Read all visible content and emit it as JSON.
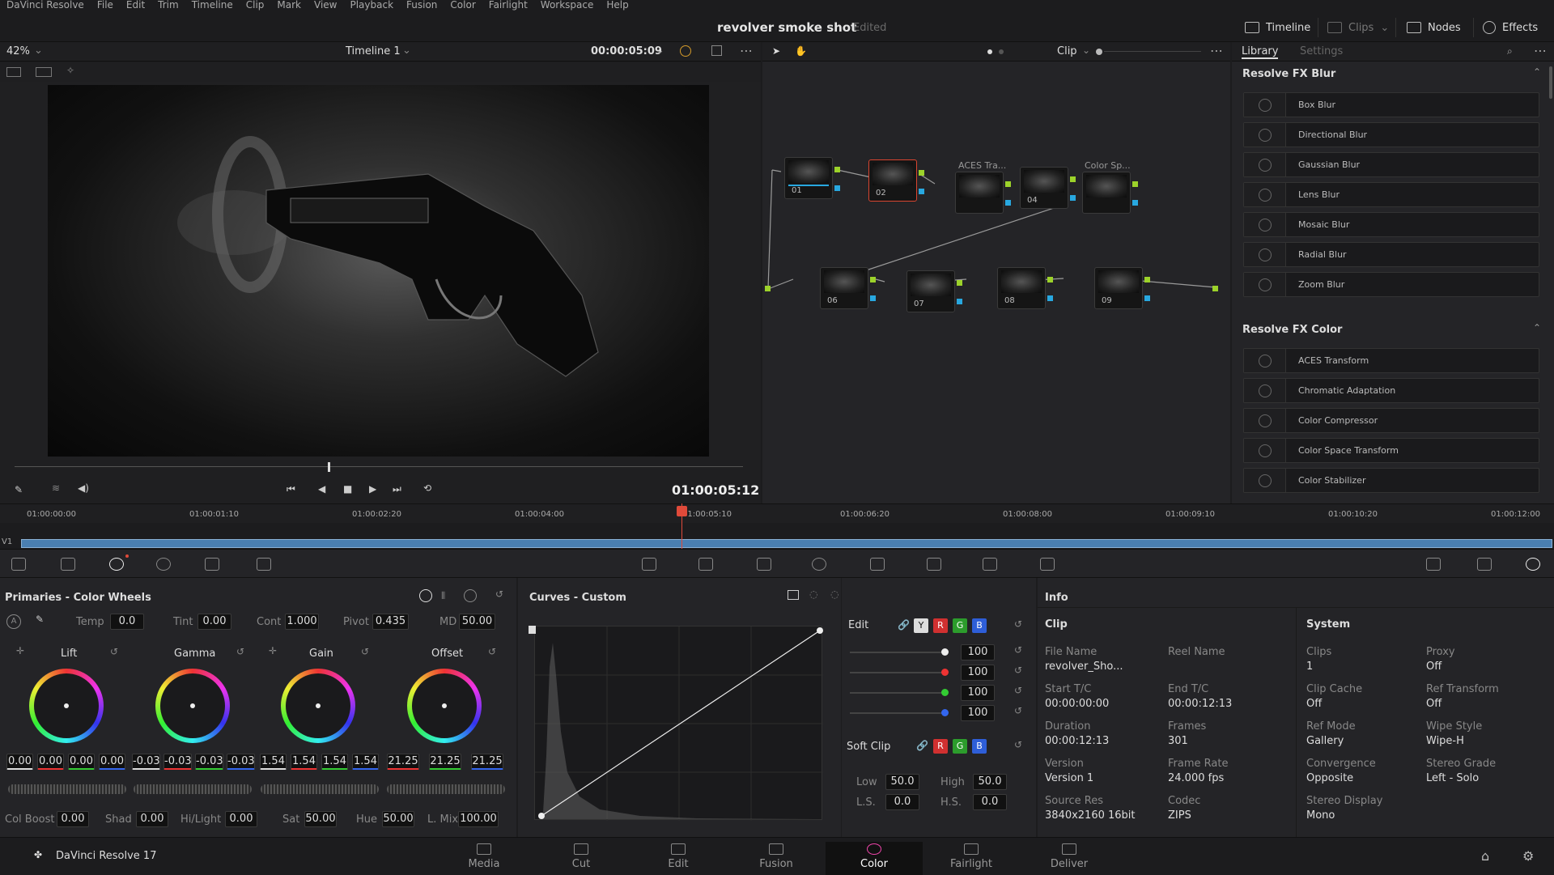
{
  "menu": [
    "DaVinci Resolve",
    "File",
    "Edit",
    "Trim",
    "Timeline",
    "Clip",
    "Mark",
    "View",
    "Playback",
    "Fusion",
    "Color",
    "Fairlight",
    "Workspace",
    "Help"
  ],
  "project": {
    "title": "revolver smoke shot",
    "status": "Edited"
  },
  "top_buttons": {
    "timeline": "Timeline",
    "clips": "Clips",
    "nodes": "Nodes",
    "effects": "Effects"
  },
  "viewer": {
    "zoom": "42%",
    "timeline_name": "Timeline 1",
    "timecode": "00:00:05:09",
    "current_tc": "01:00:05:12"
  },
  "node_editor": {
    "mode": "Clip",
    "nodes": [
      "01",
      "02",
      "04",
      "06",
      "07",
      "08",
      "09"
    ],
    "node_titles": {
      "aces": "ACES Tra...",
      "colorsp": "Color Sp..."
    }
  },
  "library": {
    "tabs": [
      "Library",
      "Settings"
    ],
    "sections": [
      {
        "title": "Resolve FX Blur",
        "items": [
          "Box Blur",
          "Directional Blur",
          "Gaussian Blur",
          "Lens Blur",
          "Mosaic Blur",
          "Radial Blur",
          "Zoom Blur"
        ]
      },
      {
        "title": "Resolve FX Color",
        "items": [
          "ACES Transform",
          "Chromatic Adaptation",
          "Color Compressor",
          "Color Space Transform",
          "Color Stabilizer"
        ]
      }
    ]
  },
  "timeline_ruler": [
    "01:00:00:00",
    "01:00:01:10",
    "01:00:02:20",
    "01:00:04:00",
    "01:00:05:10",
    "01:00:06:20",
    "01:00:08:00",
    "01:00:09:10",
    "01:00:10:20",
    "01:00:12:00"
  ],
  "track_label": "V1",
  "primaries": {
    "title": "Primaries - Color Wheels",
    "temp_label": "Temp",
    "temp": "0.0",
    "tint_label": "Tint",
    "tint": "0.00",
    "cont_label": "Cont",
    "cont": "1.000",
    "pivot_label": "Pivot",
    "pivot": "0.435",
    "md_label": "MD",
    "md": "50.00",
    "wheels": [
      {
        "name": "Lift",
        "values": [
          "0.00",
          "0.00",
          "0.00",
          "0.00"
        ]
      },
      {
        "name": "Gamma",
        "values": [
          "-0.03",
          "-0.03",
          "-0.03",
          "-0.03"
        ]
      },
      {
        "name": "Gain",
        "values": [
          "1.54",
          "1.54",
          "1.54",
          "1.54"
        ]
      },
      {
        "name": "Offset",
        "values": [
          "21.25",
          "21.25",
          "21.25"
        ]
      }
    ],
    "bottom": {
      "colboost_label": "Col Boost",
      "colboost": "0.00",
      "shad_label": "Shad",
      "shad": "0.00",
      "hilight_label": "Hi/Light",
      "hilight": "0.00",
      "sat_label": "Sat",
      "sat": "50.00",
      "hue_label": "Hue",
      "hue": "50.00",
      "lmix_label": "L. Mix",
      "lmix": "100.00"
    }
  },
  "curves": {
    "title": "Curves - Custom",
    "edit_label": "Edit",
    "channels": [
      "Y",
      "R",
      "G",
      "B"
    ],
    "edit_values": [
      "100",
      "100",
      "100",
      "100"
    ],
    "softclip_label": "Soft Clip",
    "low_label": "Low",
    "low": "50.0",
    "high_label": "High",
    "high": "50.0",
    "ls_label": "L.S.",
    "ls": "0.0",
    "hs_label": "H.S.",
    "hs": "0.0"
  },
  "info": {
    "title": "Info",
    "clip_header": "Clip",
    "clip": [
      {
        "label": "File Name",
        "value": "revolver_Sho..."
      },
      {
        "label": "Reel Name",
        "value": ""
      },
      {
        "label": "Start T/C",
        "value": "00:00:00:00"
      },
      {
        "label": "End T/C",
        "value": "00:00:12:13"
      },
      {
        "label": "Duration",
        "value": "00:00:12:13"
      },
      {
        "label": "Frames",
        "value": "301"
      },
      {
        "label": "Version",
        "value": "Version 1"
      },
      {
        "label": "Frame Rate",
        "value": "24.000 fps"
      },
      {
        "label": "Source Res",
        "value": "3840x2160 16bit"
      },
      {
        "label": "Codec",
        "value": "ZIPS"
      }
    ],
    "system_header": "System",
    "system": [
      {
        "label": "Clips",
        "value": "1"
      },
      {
        "label": "Proxy",
        "value": "Off"
      },
      {
        "label": "Clip Cache",
        "value": "Off"
      },
      {
        "label": "Ref Transform",
        "value": "Off"
      },
      {
        "label": "Ref Mode",
        "value": "Gallery"
      },
      {
        "label": "Wipe Style",
        "value": "Wipe-H"
      },
      {
        "label": "Convergence",
        "value": "Opposite"
      },
      {
        "label": "Stereo Grade",
        "value": "Left - Solo"
      },
      {
        "label": "Stereo Display",
        "value": "Mono"
      }
    ]
  },
  "app_name": "DaVinci Resolve 17",
  "pages": [
    "Media",
    "Cut",
    "Edit",
    "Fusion",
    "Color",
    "Fairlight",
    "Deliver"
  ],
  "active_page": "Color",
  "colors": {
    "accent_red": "#e04a3a",
    "node_green": "#9cd22a",
    "node_blue": "#28a8e0",
    "clip_blue": "#4a7fb1"
  }
}
